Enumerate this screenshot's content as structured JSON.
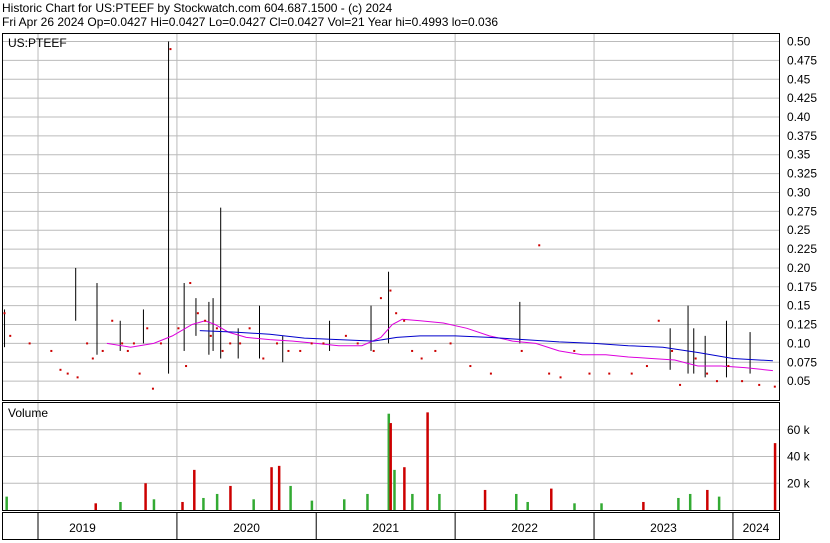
{
  "header": {
    "line1": "Historic Chart for US:PTEEF by Stockwatch.com 604.687.1500 - (c) 2024",
    "line2": "Fri Apr 26 2024   Op=0.0427  Hi=0.0427  Lo=0.0427  Cl=0.0427  Vol=21   Year hi=0.4993   lo=0.036"
  },
  "colors": {
    "price_bar": "#000000",
    "close_dot": "#cc0000",
    "ma_short": "#dd00dd",
    "ma_long": "#0000cc",
    "vol_up": "#33aa33",
    "vol_down": "#cc0000",
    "grid": "#bbbbbb"
  },
  "chart_data": [
    {
      "type": "line",
      "title": "US:PTEEF",
      "x_axis": {
        "labels": [
          "2019",
          "2020",
          "2021",
          "2022",
          "2023",
          "2024"
        ],
        "range": [
          "2018-10-01",
          "2024-05-01"
        ]
      },
      "y_axis": {
        "range": [
          0.025,
          0.51
        ],
        "ticks": [
          0.05,
          0.075,
          0.1,
          0.125,
          0.15,
          0.175,
          0.2,
          0.225,
          0.25,
          0.275,
          0.3,
          0.325,
          0.35,
          0.375,
          0.4,
          0.425,
          0.45,
          0.475,
          0.5
        ],
        "tick_labels": [
          "0.05",
          "0.075",
          "0.10",
          "0.125",
          "0.15",
          "0.175",
          "0.20",
          "0.225",
          "0.25",
          "0.275",
          "0.30",
          "0.325",
          "0.35",
          "0.375",
          "0.40",
          "0.425",
          "0.45",
          "0.475",
          "0.50"
        ]
      },
      "grid": true,
      "series": [
        {
          "kind": "high-low",
          "points": [
            [
              "2018-10-05",
              0.095,
              0.145
            ],
            [
              "2019-04-10",
              0.13,
              0.2
            ],
            [
              "2019-06-05",
              0.085,
              0.18
            ],
            [
              "2019-08-05",
              0.09,
              0.13
            ],
            [
              "2019-10-05",
              0.1,
              0.145
            ],
            [
              "2019-12-10",
              0.06,
              0.5
            ],
            [
              "2020-01-20",
              0.09,
              0.18
            ],
            [
              "2020-02-20",
              0.11,
              0.16
            ],
            [
              "2020-03-25",
              0.085,
              0.155
            ],
            [
              "2020-04-05",
              0.09,
              0.16
            ],
            [
              "2020-04-25",
              0.08,
              0.28
            ],
            [
              "2020-06-10",
              0.08,
              0.12
            ],
            [
              "2020-08-05",
              0.08,
              0.15
            ],
            [
              "2020-10-05",
              0.075,
              0.11
            ],
            [
              "2021-02-05",
              0.09,
              0.13
            ],
            [
              "2021-05-25",
              0.09,
              0.15
            ],
            [
              "2021-07-10",
              0.1,
              0.195
            ],
            [
              "2022-06-20",
              0.1,
              0.155
            ],
            [
              "2023-07-20",
              0.065,
              0.12
            ],
            [
              "2023-09-05",
              0.06,
              0.15
            ],
            [
              "2023-09-20",
              0.06,
              0.12
            ],
            [
              "2023-10-20",
              0.055,
              0.11
            ],
            [
              "2023-12-15",
              0.055,
              0.13
            ],
            [
              "2024-02-15",
              0.06,
              0.115
            ]
          ]
        },
        {
          "kind": "close-dots",
          "points": [
            [
              "2018-10-05",
              0.14
            ],
            [
              "2018-10-20",
              0.11
            ],
            [
              "2018-12-10",
              0.1
            ],
            [
              "2019-02-05",
              0.09
            ],
            [
              "2019-03-01",
              0.065
            ],
            [
              "2019-03-20",
              0.06
            ],
            [
              "2019-04-15",
              0.055
            ],
            [
              "2019-05-10",
              0.1
            ],
            [
              "2019-05-25",
              0.08
            ],
            [
              "2019-06-20",
              0.09
            ],
            [
              "2019-07-15",
              0.13
            ],
            [
              "2019-08-10",
              0.1
            ],
            [
              "2019-08-25",
              0.09
            ],
            [
              "2019-09-10",
              0.1
            ],
            [
              "2019-09-25",
              0.06
            ],
            [
              "2019-10-15",
              0.12
            ],
            [
              "2019-10-30",
              0.04
            ],
            [
              "2019-11-20",
              0.1
            ],
            [
              "2019-12-15",
              0.49
            ],
            [
              "2020-01-05",
              0.12
            ],
            [
              "2020-01-25",
              0.07
            ],
            [
              "2020-02-05",
              0.18
            ],
            [
              "2020-02-25",
              0.14
            ],
            [
              "2020-03-15",
              0.13
            ],
            [
              "2020-03-30",
              0.11
            ],
            [
              "2020-04-15",
              0.12
            ],
            [
              "2020-04-30",
              0.09
            ],
            [
              "2020-05-20",
              0.1
            ],
            [
              "2020-06-15",
              0.1
            ],
            [
              "2020-07-10",
              0.12
            ],
            [
              "2020-08-15",
              0.08
            ],
            [
              "2020-09-20",
              0.1
            ],
            [
              "2020-10-20",
              0.09
            ],
            [
              "2020-11-20",
              0.09
            ],
            [
              "2020-12-20",
              0.1
            ],
            [
              "2021-01-20",
              0.1
            ],
            [
              "2021-03-20",
              0.11
            ],
            [
              "2021-04-20",
              0.1
            ],
            [
              "2021-06-01",
              0.09
            ],
            [
              "2021-06-20",
              0.16
            ],
            [
              "2021-07-15",
              0.17
            ],
            [
              "2021-07-30",
              0.14
            ],
            [
              "2021-08-20",
              0.13
            ],
            [
              "2021-09-10",
              0.09
            ],
            [
              "2021-10-05",
              0.08
            ],
            [
              "2021-11-10",
              0.09
            ],
            [
              "2021-12-20",
              0.1
            ],
            [
              "2022-02-10",
              0.07
            ],
            [
              "2022-04-05",
              0.06
            ],
            [
              "2022-06-25",
              0.09
            ],
            [
              "2022-08-10",
              0.23
            ],
            [
              "2022-09-05",
              0.06
            ],
            [
              "2022-10-05",
              0.055
            ],
            [
              "2022-11-10",
              0.09
            ],
            [
              "2022-12-20",
              0.06
            ],
            [
              "2023-02-10",
              0.06
            ],
            [
              "2023-04-10",
              0.06
            ],
            [
              "2023-05-20",
              0.07
            ],
            [
              "2023-06-20",
              0.13
            ],
            [
              "2023-07-25",
              0.09
            ],
            [
              "2023-08-15",
              0.045
            ],
            [
              "2023-09-25",
              0.08
            ],
            [
              "2023-10-25",
              0.06
            ],
            [
              "2023-11-20",
              0.05
            ],
            [
              "2023-12-20",
              0.07
            ],
            [
              "2024-01-25",
              0.05
            ],
            [
              "2024-03-10",
              0.045
            ],
            [
              "2024-04-20",
              0.0427
            ]
          ]
        },
        {
          "kind": "moving-average-short",
          "points": [
            [
              "2019-07-01",
              0.1
            ],
            [
              "2019-09-01",
              0.095
            ],
            [
              "2019-11-01",
              0.1
            ],
            [
              "2019-12-20",
              0.11
            ],
            [
              "2020-02-10",
              0.125
            ],
            [
              "2020-03-15",
              0.13
            ],
            [
              "2020-04-10",
              0.125
            ],
            [
              "2020-05-15",
              0.115
            ],
            [
              "2020-07-01",
              0.108
            ],
            [
              "2020-09-01",
              0.105
            ],
            [
              "2020-11-01",
              0.103
            ],
            [
              "2021-01-01",
              0.1
            ],
            [
              "2021-03-01",
              0.097
            ],
            [
              "2021-05-01",
              0.097
            ],
            [
              "2021-06-20",
              0.108
            ],
            [
              "2021-07-20",
              0.125
            ],
            [
              "2021-08-15",
              0.132
            ],
            [
              "2021-10-01",
              0.13
            ],
            [
              "2021-12-01",
              0.127
            ],
            [
              "2022-02-01",
              0.12
            ],
            [
              "2022-04-01",
              0.11
            ],
            [
              "2022-06-01",
              0.103
            ],
            [
              "2022-08-01",
              0.1
            ],
            [
              "2022-10-01",
              0.09
            ],
            [
              "2022-12-01",
              0.085
            ],
            [
              "2023-02-01",
              0.085
            ],
            [
              "2023-04-01",
              0.082
            ],
            [
              "2023-06-01",
              0.08
            ],
            [
              "2023-08-01",
              0.078
            ],
            [
              "2023-10-01",
              0.07
            ],
            [
              "2023-12-01",
              0.07
            ],
            [
              "2024-02-01",
              0.068
            ],
            [
              "2024-04-15",
              0.064
            ]
          ]
        },
        {
          "kind": "moving-average-long",
          "points": [
            [
              "2020-03-01",
              0.117
            ],
            [
              "2020-06-01",
              0.115
            ],
            [
              "2020-09-01",
              0.112
            ],
            [
              "2020-12-01",
              0.107
            ],
            [
              "2021-03-01",
              0.105
            ],
            [
              "2021-06-01",
              0.103
            ],
            [
              "2021-08-01",
              0.108
            ],
            [
              "2021-10-01",
              0.11
            ],
            [
              "2022-01-01",
              0.11
            ],
            [
              "2022-04-01",
              0.108
            ],
            [
              "2022-07-01",
              0.105
            ],
            [
              "2022-10-01",
              0.102
            ],
            [
              "2023-01-01",
              0.1
            ],
            [
              "2023-04-01",
              0.097
            ],
            [
              "2023-07-01",
              0.095
            ],
            [
              "2023-10-01",
              0.088
            ],
            [
              "2024-01-01",
              0.08
            ],
            [
              "2024-04-15",
              0.077
            ]
          ]
        }
      ]
    },
    {
      "type": "bar",
      "title": "Volume",
      "x_axis": {
        "labels": [
          "2019",
          "2020",
          "2021",
          "2022",
          "2023",
          "2024"
        ],
        "range": [
          "2018-10-01",
          "2024-05-01"
        ]
      },
      "y_axis": {
        "range": [
          0,
          80000
        ],
        "ticks": [
          20000,
          40000,
          60000
        ],
        "tick_labels": [
          "20 k",
          "40 k",
          "60 k"
        ]
      },
      "grid": true,
      "bars": [
        [
          "2018-10-10",
          10000,
          "up"
        ],
        [
          "2019-06-01",
          5000,
          "down"
        ],
        [
          "2019-08-05",
          6000,
          "up"
        ],
        [
          "2019-10-10",
          20000,
          "down"
        ],
        [
          "2019-11-01",
          8000,
          "up"
        ],
        [
          "2020-01-15",
          6000,
          "down"
        ],
        [
          "2020-02-15",
          30000,
          "down"
        ],
        [
          "2020-03-10",
          9000,
          "up"
        ],
        [
          "2020-04-15",
          12000,
          "up"
        ],
        [
          "2020-05-20",
          18000,
          "down"
        ],
        [
          "2020-07-20",
          8000,
          "up"
        ],
        [
          "2020-09-05",
          32000,
          "down"
        ],
        [
          "2020-09-25",
          33000,
          "down"
        ],
        [
          "2020-10-25",
          18000,
          "up"
        ],
        [
          "2020-12-20",
          7000,
          "up"
        ],
        [
          "2021-03-15",
          8000,
          "up"
        ],
        [
          "2021-05-15",
          12000,
          "up"
        ],
        [
          "2021-07-10",
          72000,
          "up"
        ],
        [
          "2021-07-15",
          65000,
          "down"
        ],
        [
          "2021-07-25",
          30000,
          "up"
        ],
        [
          "2021-08-20",
          32000,
          "down"
        ],
        [
          "2021-09-10",
          12000,
          "up"
        ],
        [
          "2021-10-20",
          73000,
          "down"
        ],
        [
          "2021-11-20",
          12000,
          "up"
        ],
        [
          "2022-03-20",
          15000,
          "down"
        ],
        [
          "2022-06-10",
          12000,
          "up"
        ],
        [
          "2022-07-10",
          6000,
          "up"
        ],
        [
          "2022-09-10",
          16000,
          "down"
        ],
        [
          "2022-11-10",
          5000,
          "up"
        ],
        [
          "2023-01-20",
          5000,
          "up"
        ],
        [
          "2023-05-10",
          6000,
          "down"
        ],
        [
          "2023-08-10",
          9000,
          "up"
        ],
        [
          "2023-09-10",
          12000,
          "up"
        ],
        [
          "2023-10-25",
          15000,
          "down"
        ],
        [
          "2023-11-25",
          10000,
          "up"
        ],
        [
          "2024-04-20",
          50000,
          "down"
        ]
      ]
    }
  ]
}
